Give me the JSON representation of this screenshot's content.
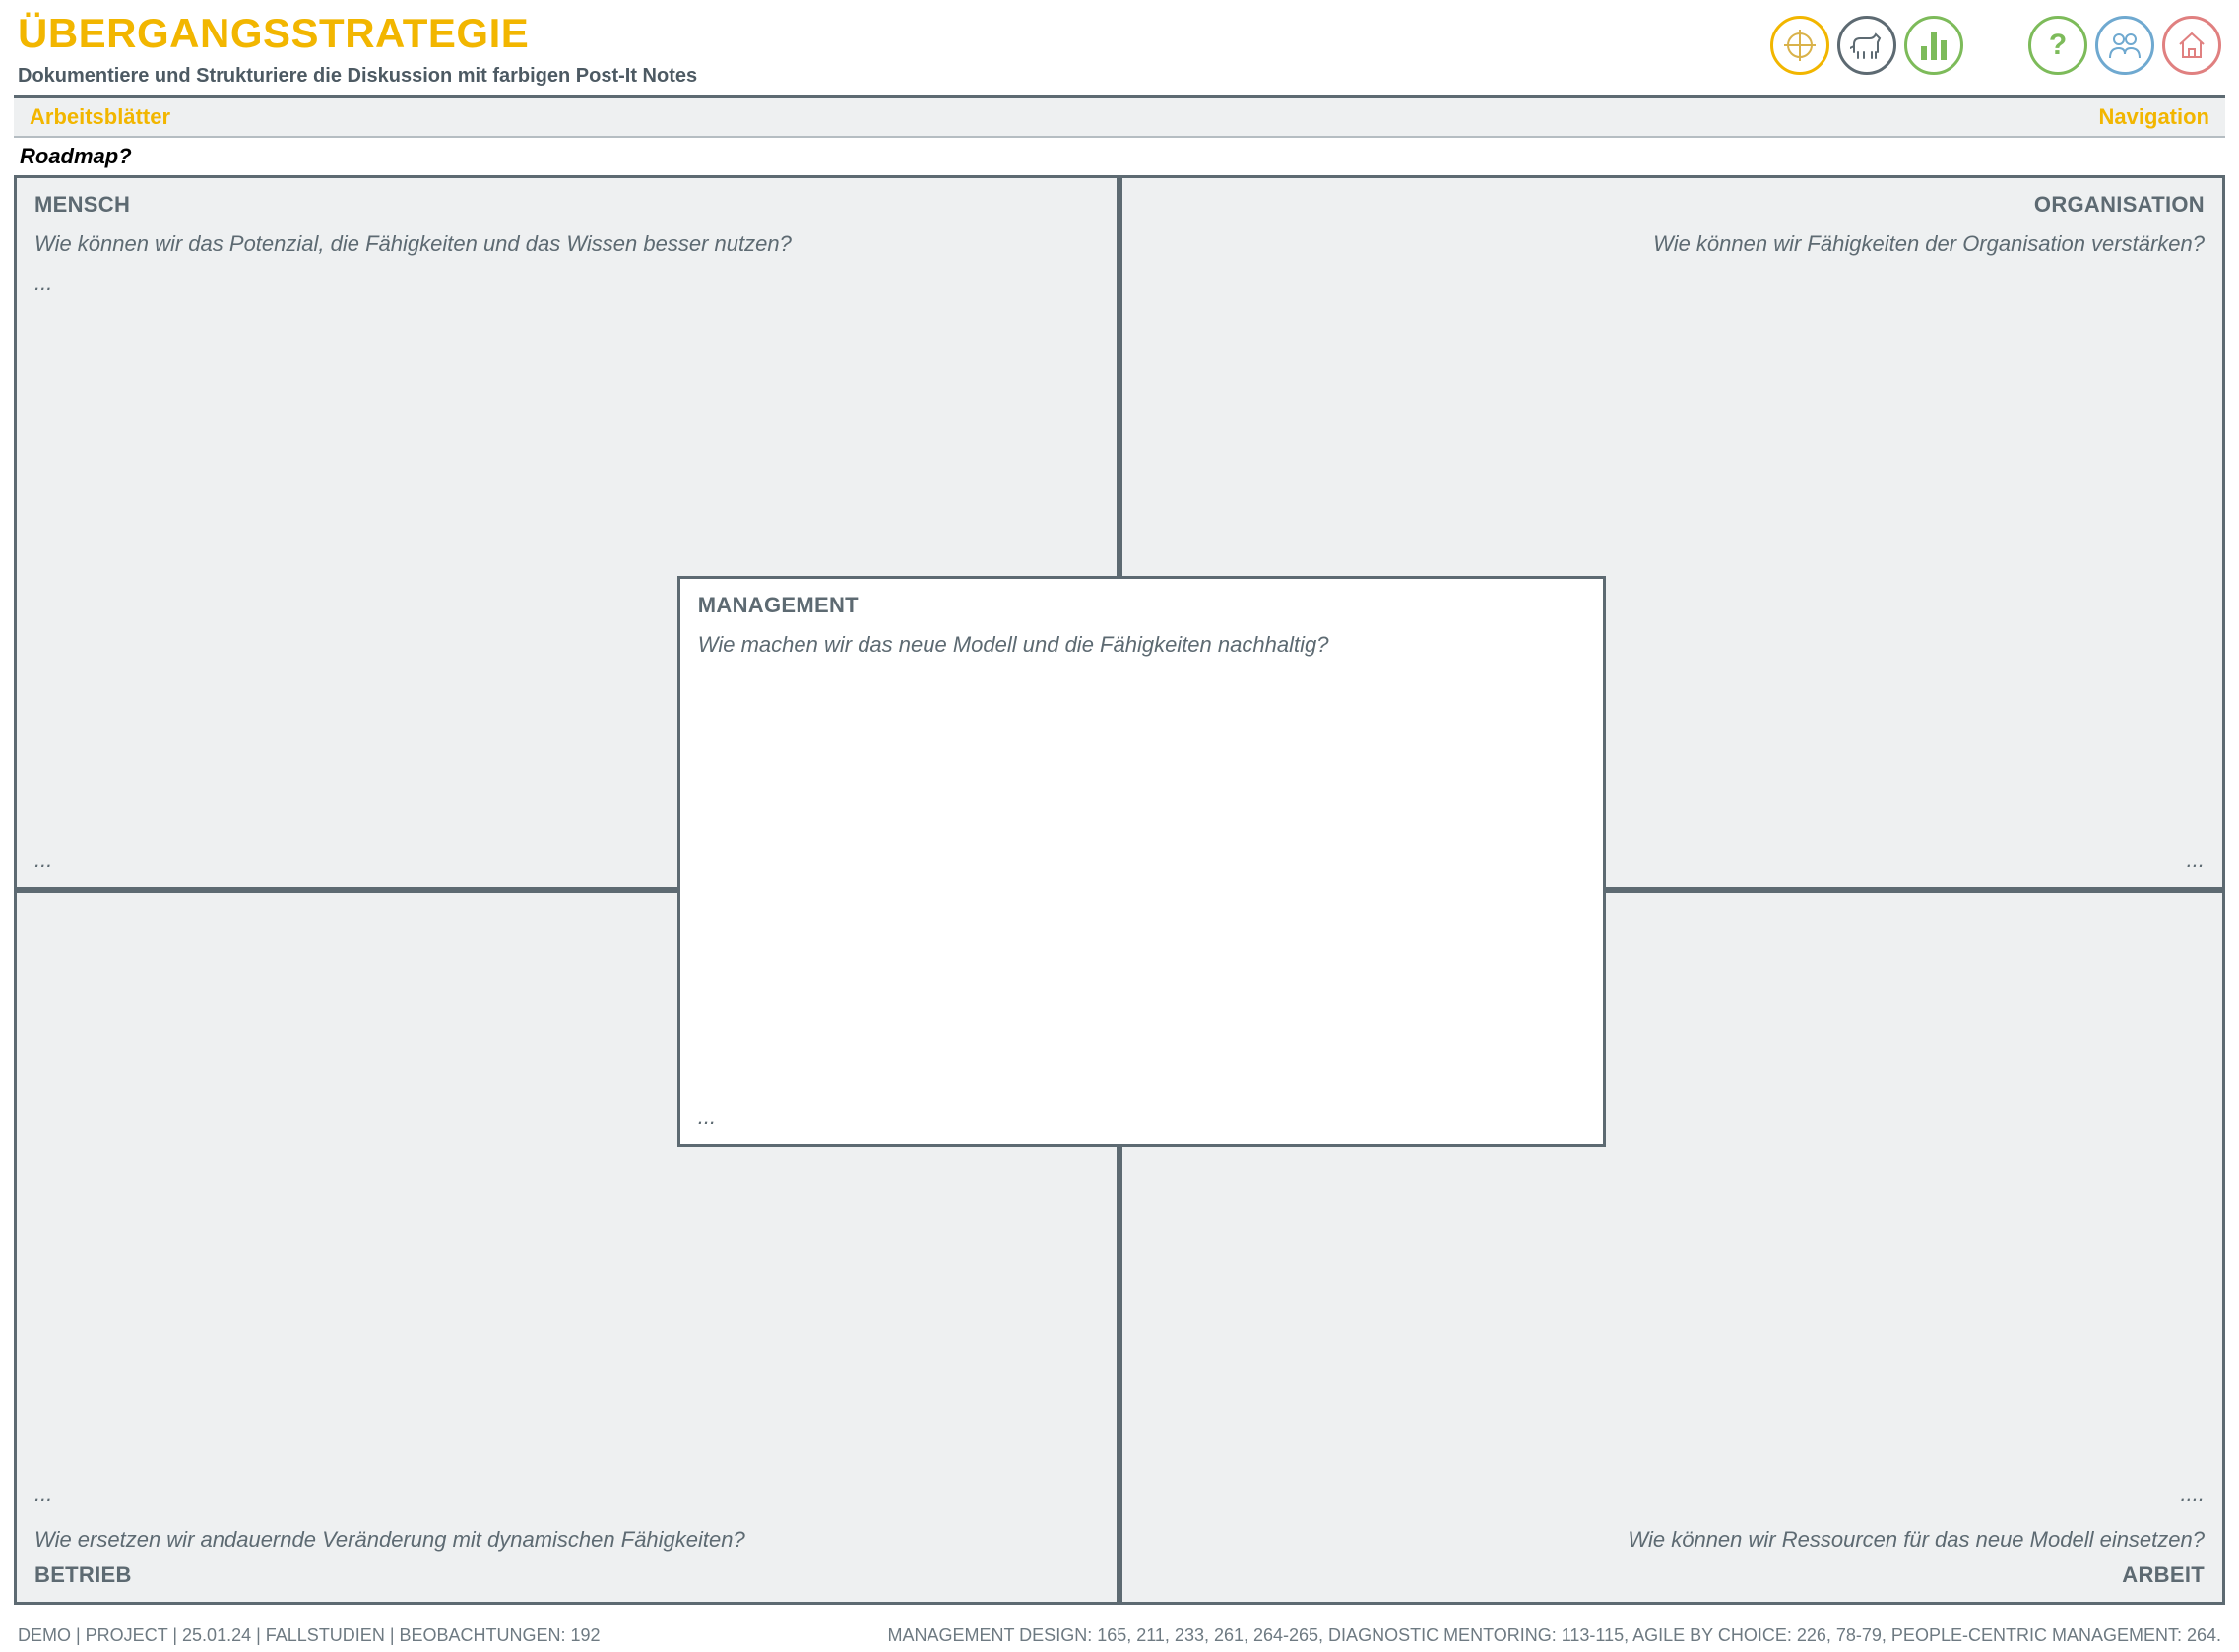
{
  "header": {
    "title": "ÜBERGANGSSTRATEGIE",
    "subtitle": "Dokumentiere und Strukturiere die Diskussion mit farbigen Post-It Notes",
    "icons": {
      "target": "target-icon",
      "dog": "agile-dog-icon",
      "chart": "bar-chart-icon",
      "help": "?",
      "people": "people-icon",
      "home": "home-icon"
    }
  },
  "section_bar": {
    "left": "Arbeitsblätter",
    "right": "Navigation"
  },
  "canvas": {
    "roadmap_label": "Roadmap?",
    "quadrants": {
      "mensch": {
        "title": "MENSCH",
        "prompt": "Wie können wir das Potenzial, die Fähigkeiten und das Wissen besser nutzen?",
        "dots_top": "...",
        "dots_bottom": "..."
      },
      "organisation": {
        "title": "ORGANISATION",
        "prompt": "Wie können wir Fähigkeiten der Organisation verstärken?",
        "dots_bottom": "..."
      },
      "betrieb": {
        "title": "BETRIEB",
        "prompt": "Wie ersetzen wir andauernde Veränderung mit dynamischen Fähigkeiten?",
        "dots": "..."
      },
      "arbeit": {
        "title": "ARBEIT",
        "prompt": "Wie können wir Ressourcen für das neue Modell einsetzen?",
        "dots": "...."
      }
    },
    "center": {
      "title": "MANAGEMENT",
      "prompt": "Wie machen wir das neue Modell und die Fähigkeiten nachhaltig?",
      "dots": "..."
    }
  },
  "footer": {
    "left": "DEMO  |  PROJECT  |  25.01.24  |  FALLSTUDIEN  |  BEOBACHTUNGEN: 192",
    "right": "MANAGEMENT DESIGN: 165, 211, 233, 261, 264-265, DIAGNOSTIC MENTORING: 113-115, AGILE BY CHOICE: 226, 78-79, PEOPLE-CENTRIC MANAGEMENT: 264."
  }
}
